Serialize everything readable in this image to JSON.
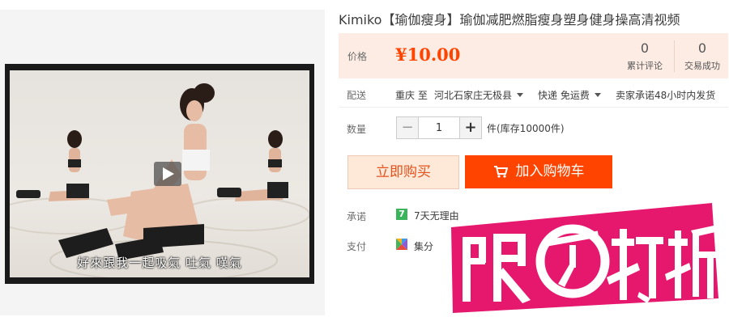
{
  "video": {
    "subtitle": "好來跟我一起吸氣 吐氣 嘆氣"
  },
  "product": {
    "title": "Kimiko【瑜伽瘦身】瑜伽减肥燃脂瘦身塑身健身操高清视频"
  },
  "price": {
    "label": "价格",
    "value": "¥10.00",
    "reviews_count": "0",
    "reviews_label": "累计评论",
    "sales_count": "0",
    "sales_label": "交易成功"
  },
  "shipping": {
    "label": "配送",
    "from": "重庆 至",
    "to": "河北石家庄无极县",
    "method": "快递 免运费",
    "promise": "卖家承诺48小时内发货"
  },
  "quantity": {
    "label": "数量",
    "minus": "−",
    "value": "1",
    "plus": "+",
    "stock": "件(库存10000件)"
  },
  "actions": {
    "buy_now": "立即购买",
    "add_to_cart": "加入购物车"
  },
  "promise": {
    "label": "承诺",
    "icon_text": "7",
    "text": "7天无理由"
  },
  "payment": {
    "label": "支付",
    "text": "集分"
  },
  "promo": {
    "text": "限时打折"
  },
  "colors": {
    "accent": "#ff4400",
    "price_bg": "#fcece4",
    "promo_pink": "#e6186e"
  }
}
